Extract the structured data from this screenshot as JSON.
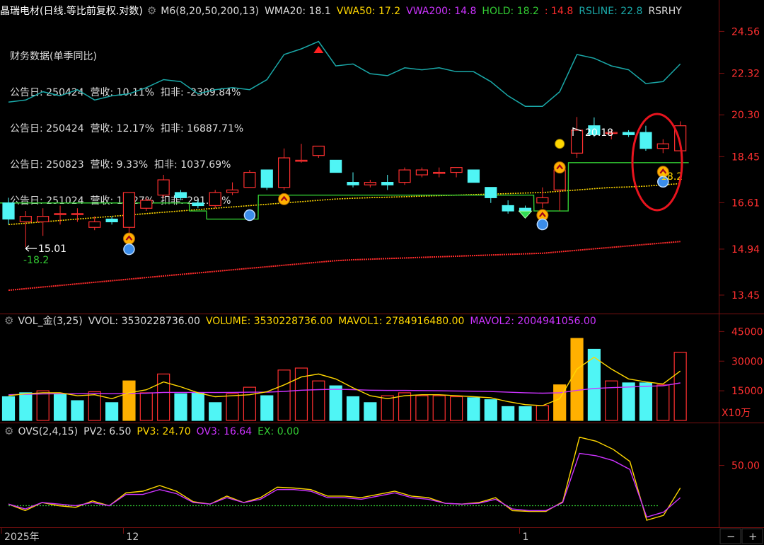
{
  "header_main": {
    "stock_name": "晶瑞电材",
    "period": "(日线.等比前复权.对数)",
    "indicators": [
      {
        "label": "M6(8,20,50,200,13)",
        "color": "#dddddd"
      },
      {
        "label": "WMA20: 18.1",
        "color": "#dddddd"
      },
      {
        "label": "VWA50: 17.2",
        "color": "#ffd700"
      },
      {
        "label": "VWA200: 14.8",
        "color": "#cc33ff"
      },
      {
        "label": "HOLD: 18.2",
        "color": "#33cc33"
      },
      {
        "label": ": 14.8",
        "color": "#ff2b2b"
      },
      {
        "label": "RSLINE: 22.8",
        "color": "#1aa8a8"
      },
      {
        "label": "RSRHY",
        "color": "#dddddd"
      }
    ]
  },
  "financial": {
    "title": "财务数据(单季同比)",
    "rows": [
      "公告日: 250424  营收: 10.11%  扣非: -2309.84%",
      "公告日: 250424  营收: 12.17%  扣非: 16887.71%",
      "公告日: 250823  营收: 9.33%  扣非: 1037.69%",
      "公告日: 251024  营收: 14.27%  扣非: 291.48%"
    ]
  },
  "header_vol": {
    "indicators": [
      {
        "label": "VOL_金(3,25)",
        "color": "#dddddd"
      },
      {
        "label": "VVOL: 3530228736.00",
        "color": "#dddddd"
      },
      {
        "label": "VOLUME: 3530228736.00",
        "color": "#ffd700"
      },
      {
        "label": "MAVOL1: 2784916480.00",
        "color": "#ffd700"
      },
      {
        "label": "MAVOL2: 2004941056.00",
        "color": "#cc33ff"
      }
    ]
  },
  "header_ovs": {
    "indicators": [
      {
        "label": "OVS(2,4,15)",
        "color": "#dddddd"
      },
      {
        "label": "PV2: 6.50",
        "color": "#dddddd"
      },
      {
        "label": "PV3: 24.70",
        "color": "#ffd700"
      },
      {
        "label": "OV3: 16.64",
        "color": "#cc33ff"
      },
      {
        "label": "EX: 0.00",
        "color": "#33cc33"
      }
    ]
  },
  "price_axis": {
    "ticks": [
      "24.56",
      "22.32",
      "20.30",
      "18.45",
      "16.61",
      "14.94",
      "13.45"
    ],
    "values": [
      24.56,
      22.32,
      20.3,
      18.45,
      16.61,
      14.94,
      13.45
    ]
  },
  "vol_axis": {
    "ticks": [
      "45000",
      "30000",
      "15000"
    ],
    "values": [
      45000,
      30000,
      15000
    ],
    "unit": "X10万"
  },
  "ovs_axis": {
    "ticks": [
      "50.00"
    ],
    "values": [
      50
    ]
  },
  "time_axis": {
    "labels": [
      "2025年",
      "12",
      "1"
    ],
    "label_index": [
      0,
      7,
      30
    ]
  },
  "annotations": {
    "high": "20.18",
    "low": "15.01",
    "low_sub": "-18.2",
    "right_label": "18.2"
  },
  "zoom": {
    "minus": "−",
    "plus": "+"
  },
  "colors": {
    "up": "#ff3030",
    "down": "#4ff5f5",
    "vol_up": "#ff3030",
    "vol_down": "#4ff5f5",
    "vol_special": "#ffb000",
    "rsline": "#1aa8a8",
    "hold": "#33cc33",
    "vwa50": "#ffd700",
    "vwa200": "#ff2b2b",
    "mavol1": "#ffd700",
    "mavol2": "#cc33ff"
  },
  "chart_data": [
    {
      "type": "candlestick",
      "title": "晶瑞电材",
      "ylim": [
        13.0,
        25.3
      ],
      "log_scale": true,
      "candles": [
        {
          "o": 16.6,
          "h": 16.8,
          "l": 15.8,
          "c": 16.0
        },
        {
          "o": 15.9,
          "h": 16.3,
          "l": 15.01,
          "c": 16.1
        },
        {
          "o": 15.9,
          "h": 16.4,
          "l": 15.4,
          "c": 16.1
        },
        {
          "o": 16.2,
          "h": 16.5,
          "l": 15.8,
          "c": 16.2
        },
        {
          "o": 16.2,
          "h": 16.4,
          "l": 15.9,
          "c": 16.2
        },
        {
          "o": 15.7,
          "h": 16.1,
          "l": 15.6,
          "c": 15.9
        },
        {
          "o": 16.0,
          "h": 16.1,
          "l": 15.8,
          "c": 15.9
        },
        {
          "o": 15.7,
          "h": 17.0,
          "l": 15.5,
          "c": 17.0
        },
        {
          "o": 16.4,
          "h": 16.8,
          "l": 16.3,
          "c": 16.7
        },
        {
          "o": 16.9,
          "h": 17.7,
          "l": 16.8,
          "c": 17.5
        },
        {
          "o": 17.0,
          "h": 17.1,
          "l": 16.7,
          "c": 16.8
        },
        {
          "o": 16.6,
          "h": 16.7,
          "l": 16.4,
          "c": 16.5
        },
        {
          "o": 16.5,
          "h": 17.1,
          "l": 16.4,
          "c": 17.0
        },
        {
          "o": 17.0,
          "h": 17.4,
          "l": 16.9,
          "c": 17.1
        },
        {
          "o": 17.2,
          "h": 17.9,
          "l": 17.2,
          "c": 17.8
        },
        {
          "o": 17.9,
          "h": 17.9,
          "l": 17.1,
          "c": 17.2
        },
        {
          "o": 17.2,
          "h": 18.8,
          "l": 17.1,
          "c": 18.4
        },
        {
          "o": 18.3,
          "h": 19.0,
          "l": 18.2,
          "c": 18.3
        },
        {
          "o": 18.5,
          "h": 18.9,
          "l": 18.4,
          "c": 18.9
        },
        {
          "o": 18.3,
          "h": 18.3,
          "l": 17.8,
          "c": 17.8
        },
        {
          "o": 17.4,
          "h": 17.8,
          "l": 17.2,
          "c": 17.3
        },
        {
          "o": 17.3,
          "h": 17.5,
          "l": 17.2,
          "c": 17.4
        },
        {
          "o": 17.4,
          "h": 17.7,
          "l": 17.1,
          "c": 17.3
        },
        {
          "o": 17.4,
          "h": 18.0,
          "l": 17.3,
          "c": 17.9
        },
        {
          "o": 17.7,
          "h": 18.0,
          "l": 17.6,
          "c": 17.9
        },
        {
          "o": 17.8,
          "h": 18.0,
          "l": 17.6,
          "c": 17.8
        },
        {
          "o": 17.8,
          "h": 18.0,
          "l": 17.6,
          "c": 18.0
        },
        {
          "o": 17.9,
          "h": 17.9,
          "l": 17.4,
          "c": 17.4
        },
        {
          "o": 17.2,
          "h": 17.2,
          "l": 16.6,
          "c": 16.8
        },
        {
          "o": 16.5,
          "h": 16.7,
          "l": 16.2,
          "c": 16.3
        },
        {
          "o": 16.4,
          "h": 16.5,
          "l": 16.2,
          "c": 16.3
        },
        {
          "o": 16.6,
          "h": 17.2,
          "l": 16.4,
          "c": 16.8
        },
        {
          "o": 17.1,
          "h": 18.0,
          "l": 16.3,
          "c": 17.9
        },
        {
          "o": 18.6,
          "h": 20.2,
          "l": 18.4,
          "c": 19.6
        },
        {
          "o": 19.8,
          "h": 20.18,
          "l": 19.3,
          "c": 19.4
        },
        {
          "o": 19.5,
          "h": 19.6,
          "l": 19.2,
          "c": 19.5
        },
        {
          "o": 19.5,
          "h": 19.6,
          "l": 19.3,
          "c": 19.4
        },
        {
          "o": 19.5,
          "h": 19.8,
          "l": 18.7,
          "c": 18.8
        },
        {
          "o": 18.8,
          "h": 19.2,
          "l": 18.6,
          "c": 19.0
        },
        {
          "o": 18.7,
          "h": 20.0,
          "l": 18.7,
          "c": 19.8
        }
      ],
      "rsline": [
        20.9,
        21.0,
        21.4,
        21.2,
        21.5,
        21.0,
        21.2,
        21.3,
        21.6,
        22.0,
        21.9,
        21.3,
        21.5,
        21.6,
        21.5,
        22.0,
        23.3,
        23.6,
        24.0,
        22.7,
        22.8,
        22.3,
        22.2,
        22.6,
        22.5,
        22.6,
        22.4,
        22.4,
        21.9,
        21.2,
        20.7,
        20.7,
        21.4,
        23.3,
        23.1,
        22.7,
        22.5,
        21.8,
        21.9,
        22.8
      ],
      "hold": [
        16.6,
        16.6,
        16.6,
        16.6,
        16.6,
        16.6,
        16.6,
        16.6,
        16.6,
        16.6,
        16.6,
        16.3,
        16.0,
        16.0,
        16.0,
        16.9,
        16.9,
        16.9,
        16.9,
        16.9,
        16.9,
        16.9,
        16.9,
        16.9,
        16.9,
        16.9,
        16.9,
        16.9,
        16.9,
        16.9,
        16.9,
        16.3,
        16.3,
        18.2,
        18.2,
        18.2,
        18.2,
        18.2,
        18.2,
        18.2
      ],
      "vwa50": [
        15.8,
        15.85,
        15.9,
        15.95,
        16.0,
        16.05,
        16.1,
        16.15,
        16.2,
        16.25,
        16.3,
        16.35,
        16.4,
        16.45,
        16.5,
        16.55,
        16.6,
        16.65,
        16.7,
        16.75,
        16.78,
        16.8,
        16.82,
        16.84,
        16.86,
        16.88,
        16.9,
        16.92,
        16.94,
        16.96,
        16.98,
        17.0,
        17.05,
        17.1,
        17.15,
        17.2,
        17.22,
        17.25,
        17.3,
        17.35
      ],
      "vwa200": [
        13.6,
        13.65,
        13.7,
        13.75,
        13.8,
        13.85,
        13.9,
        13.95,
        14.0,
        14.05,
        14.1,
        14.15,
        14.2,
        14.25,
        14.3,
        14.35,
        14.4,
        14.45,
        14.5,
        14.55,
        14.58,
        14.6,
        14.62,
        14.64,
        14.66,
        14.68,
        14.7,
        14.72,
        14.74,
        14.76,
        14.78,
        14.8,
        14.85,
        14.9,
        14.95,
        15.0,
        15.05,
        15.1,
        15.15,
        15.2
      ]
    },
    {
      "type": "bar",
      "title": "VOL_金(3,25)",
      "ylim": [
        0,
        48000
      ],
      "values": [
        12000,
        14000,
        15000,
        13500,
        10000,
        14500,
        9000,
        20000,
        14000,
        23500,
        13500,
        14000,
        9000,
        13500,
        16800,
        12500,
        25500,
        26500,
        20000,
        17500,
        12000,
        9000,
        12500,
        14000,
        12500,
        12500,
        12000,
        11500,
        10500,
        7000,
        7000,
        7500,
        18000,
        41500,
        36000,
        20000,
        19000,
        19000,
        18000,
        34500
      ],
      "up": [
        false,
        false,
        true,
        false,
        false,
        true,
        false,
        true,
        true,
        true,
        false,
        false,
        false,
        true,
        true,
        false,
        true,
        true,
        true,
        false,
        false,
        false,
        true,
        true,
        true,
        true,
        true,
        false,
        false,
        false,
        false,
        true,
        true,
        true,
        false,
        true,
        false,
        false,
        true,
        true
      ],
      "special": [
        false,
        false,
        false,
        false,
        false,
        false,
        false,
        true,
        false,
        false,
        false,
        false,
        false,
        false,
        false,
        false,
        false,
        false,
        false,
        false,
        false,
        false,
        false,
        false,
        false,
        false,
        false,
        false,
        false,
        false,
        false,
        false,
        true,
        true,
        false,
        false,
        false,
        false,
        false,
        false
      ],
      "mavol1": [
        12500,
        13500,
        14000,
        14000,
        12500,
        13000,
        11000,
        14000,
        15500,
        19500,
        17000,
        14000,
        12000,
        12500,
        13000,
        14500,
        18000,
        22000,
        23500,
        21000,
        16500,
        12500,
        11000,
        12500,
        13000,
        13000,
        12500,
        12000,
        11500,
        9500,
        8000,
        7500,
        11000,
        26000,
        32000,
        26000,
        21000,
        19500,
        18500,
        25000
      ],
      "mavol2": [
        13000,
        13200,
        13400,
        13500,
        13500,
        13600,
        13500,
        13700,
        13800,
        14200,
        14200,
        14200,
        14100,
        14200,
        14300,
        14300,
        14700,
        15300,
        15600,
        15800,
        15600,
        15300,
        15200,
        15200,
        15100,
        15000,
        14900,
        14800,
        14600,
        14300,
        14000,
        13800,
        14000,
        15200,
        16200,
        16600,
        16900,
        17300,
        17500,
        19000
      ]
    },
    {
      "type": "line",
      "title": "OVS(2,4,15)",
      "ylim": [
        -25,
        90
      ],
      "series": [
        {
          "name": "PV3",
          "values": [
            2,
            -6,
            4,
            0,
            -2,
            6,
            0,
            16,
            18,
            25,
            18,
            5,
            2,
            12,
            4,
            10,
            23,
            22,
            20,
            12,
            12,
            10,
            14,
            18,
            12,
            10,
            3,
            2,
            4,
            10,
            -6,
            -7,
            -7,
            5,
            85,
            80,
            70,
            55,
            -18,
            -12,
            22
          ]
        },
        {
          "name": "OV3",
          "values": [
            2,
            -4,
            4,
            2,
            0,
            4,
            0,
            14,
            14,
            20,
            15,
            4,
            2,
            10,
            4,
            8,
            20,
            20,
            18,
            10,
            10,
            8,
            12,
            16,
            10,
            8,
            3,
            2,
            3,
            8,
            -4,
            -6,
            -6,
            4,
            65,
            62,
            56,
            45,
            -14,
            -8,
            10
          ]
        }
      ],
      "ex": 0
    }
  ]
}
